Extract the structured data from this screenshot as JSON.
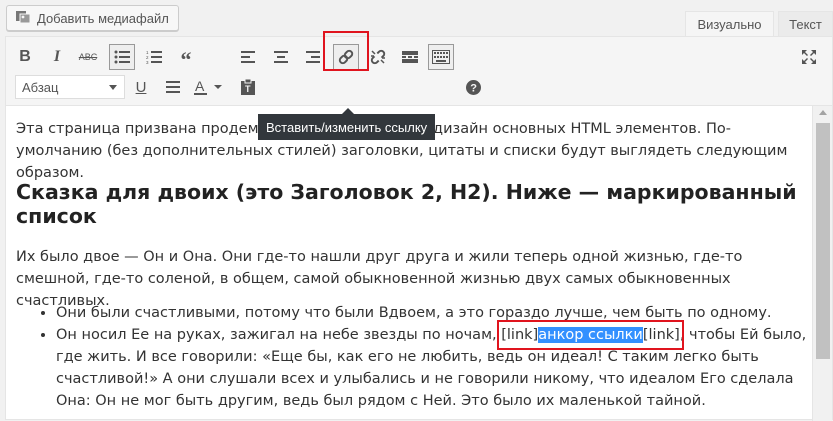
{
  "media_button": {
    "label": "Добавить медиафайл",
    "icon": "media-icon"
  },
  "tabs": [
    {
      "label": "Визуально",
      "active": true
    },
    {
      "label": "Текст",
      "active": false
    }
  ],
  "toolbar": {
    "row1": [
      "bold-icon",
      "italic-icon",
      "strikethrough-icon",
      "bullet-list-icon",
      "numbered-list-icon",
      "blockquote-icon",
      "align-left-icon",
      "align-center-icon",
      "align-right-icon",
      "insert-link-icon",
      "unlink-icon",
      "read-more-icon",
      "toolbar-toggle-icon",
      "fullscreen-icon"
    ],
    "row2": [
      "format-select",
      "underline-icon",
      "justify-icon",
      "text-color-icon",
      "paste-text-icon",
      "help-icon"
    ],
    "format_value": "Абзац"
  },
  "tooltip": {
    "text": "Вставить/изменить ссылку"
  },
  "content": {
    "intro": "Эта страница призвана продемонстрировать для Вас дизайн основных HTML элементов. По-умолчанию (без дополнительных стилей) заголовки, цитаты и списки будут выглядеть следующим образом.",
    "heading": "Сказка для двоих (это Заголовок 2, Н2). Ниже — маркированный список",
    "para2": "Их было двое — Он и Она. Они где-то нашли друг друга и жили теперь одной жизнью, где-то смешной, где-то соленой, в общем, самой обыкновенной жизнью двух самых обыкновенных счастливых.",
    "item1": "Они были счастливыми, потому что были Вдвоем, а это гораздо лучше, чем быть по одному.",
    "item2_before": "Он носил Ее на руках, зажигал на небе звезды по ночам, ",
    "item2_open": "[link]",
    "item2_anchor": "анкор ссылки",
    "item2_close": "[link]",
    "item2_after": ", чтобы Ей было, где жить. И все говорили: «Еще бы, как его не любить, ведь он идеал! С таким легко быть счастливой!» А они слушали всех и улыбались и не говорили никому, что идеалом Его сделала Она: Он не мог быть другим, ведь был рядом с Ней. Это было их маленькой тайной."
  },
  "colors": {
    "highlight_border": "#e0141e",
    "selection": "#3390ff",
    "tooltip_bg": "#32373c"
  }
}
